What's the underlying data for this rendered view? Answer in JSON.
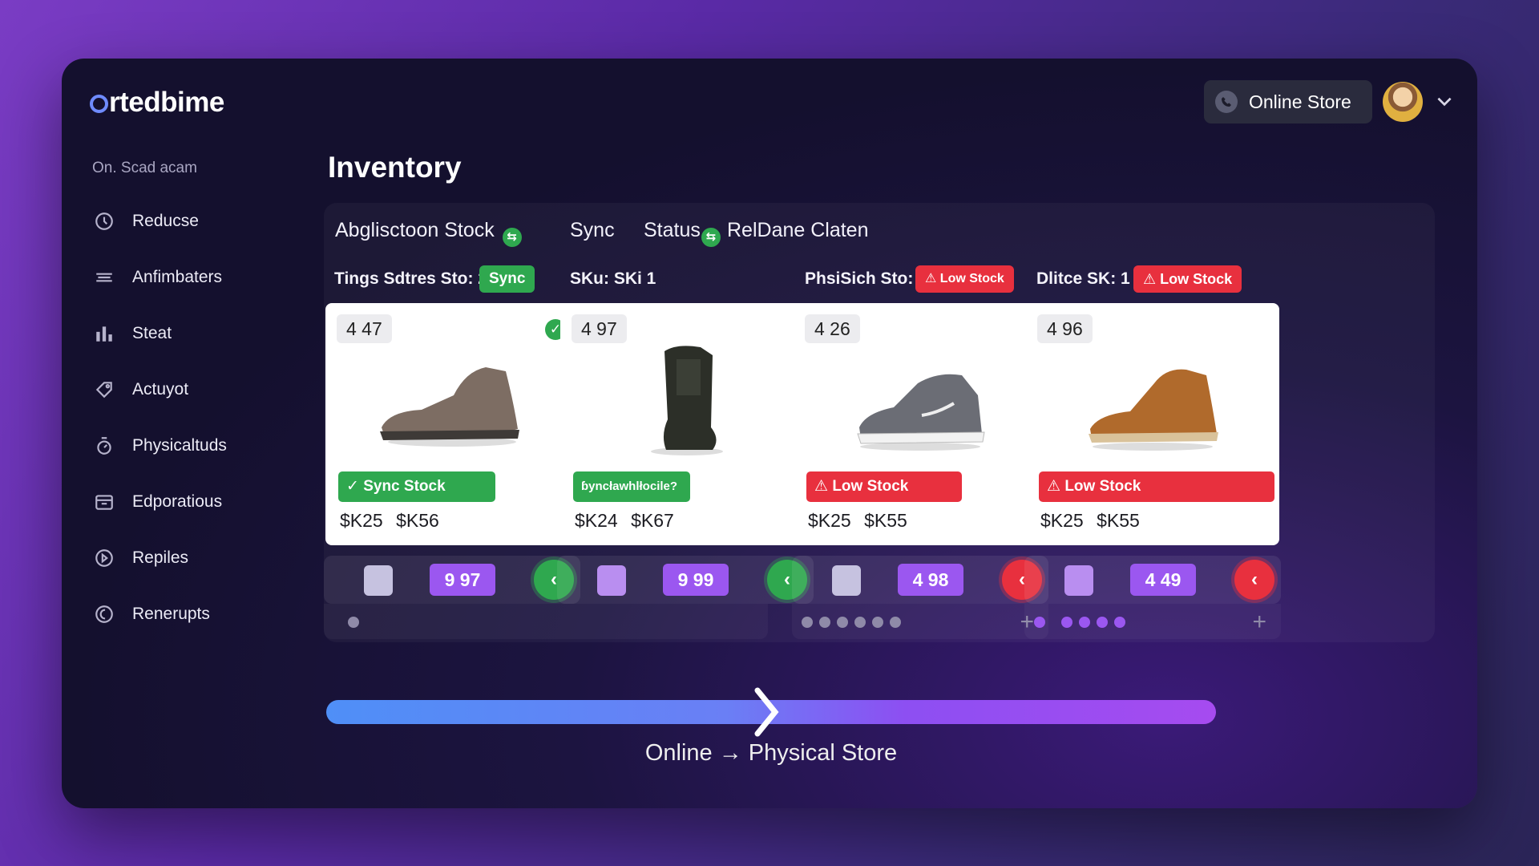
{
  "app": {
    "logo": "rtedbime"
  },
  "topbar": {
    "store_label": "Online Store"
  },
  "sidebar": {
    "header": "On. Scad acam",
    "items": [
      {
        "label": "Reducse",
        "icon": "clock-icon"
      },
      {
        "label": "Anfimbaters",
        "icon": "lines-icon"
      },
      {
        "label": "Steat",
        "icon": "bar-chart-icon"
      },
      {
        "label": "Actuyot",
        "icon": "tag-icon"
      },
      {
        "label": "Physicaltuds",
        "icon": "timer-icon"
      },
      {
        "label": "Edporatious",
        "icon": "folder-icon"
      },
      {
        "label": "Repiles",
        "icon": "play-circle-icon"
      },
      {
        "label": "Renerupts",
        "icon": "moon-icon"
      }
    ]
  },
  "main": {
    "title": "Inventory",
    "header": {
      "stock_label": "Abglisctoon Stock",
      "sync_label": "Sync",
      "status_label": "Status",
      "status_value": "RelDane Claten"
    },
    "columns": [
      {
        "label": "Tings Sdtres Sto: 2",
        "pill": "Sync",
        "pill_type": "green"
      },
      {
        "label": "SKu: SKi 1",
        "pill": "",
        "pill_type": ""
      },
      {
        "label": "PhsiSich Sto: 2",
        "pill": "Low Stock",
        "pill_type": "red"
      },
      {
        "label": "Dlitce SK: 1",
        "pill": "Low Stock",
        "pill_type": "red"
      }
    ],
    "products": [
      {
        "count": "4 47",
        "badge": "Sync Stock",
        "price1": "$K25",
        "price2": "$K56",
        "qty": "9 97",
        "shoe_color": "#7d6d63"
      },
      {
        "count": "4 97",
        "badge": "ɓyncławhlłocile?",
        "price1": "$K24",
        "price2": "$K67",
        "qty": "9 99",
        "shoe_color": "#2c2f28"
      },
      {
        "count": "4 26",
        "badge": "Low Stock",
        "price1": "$K25",
        "price2": "$K55",
        "qty": "4 98",
        "shoe_color": "#6b6d75"
      },
      {
        "count": "4 96",
        "badge": "Low Stock",
        "price1": "$K25",
        "price2": "$K55",
        "qty": "4 49",
        "shoe_color": "#b06a2c"
      }
    ],
    "transfer_label": "Online → Physical Store"
  },
  "colors": {
    "green": "#2fa84f",
    "red": "#e8303e",
    "violet": "#9b57f0",
    "blue": "#4f8ff7"
  }
}
